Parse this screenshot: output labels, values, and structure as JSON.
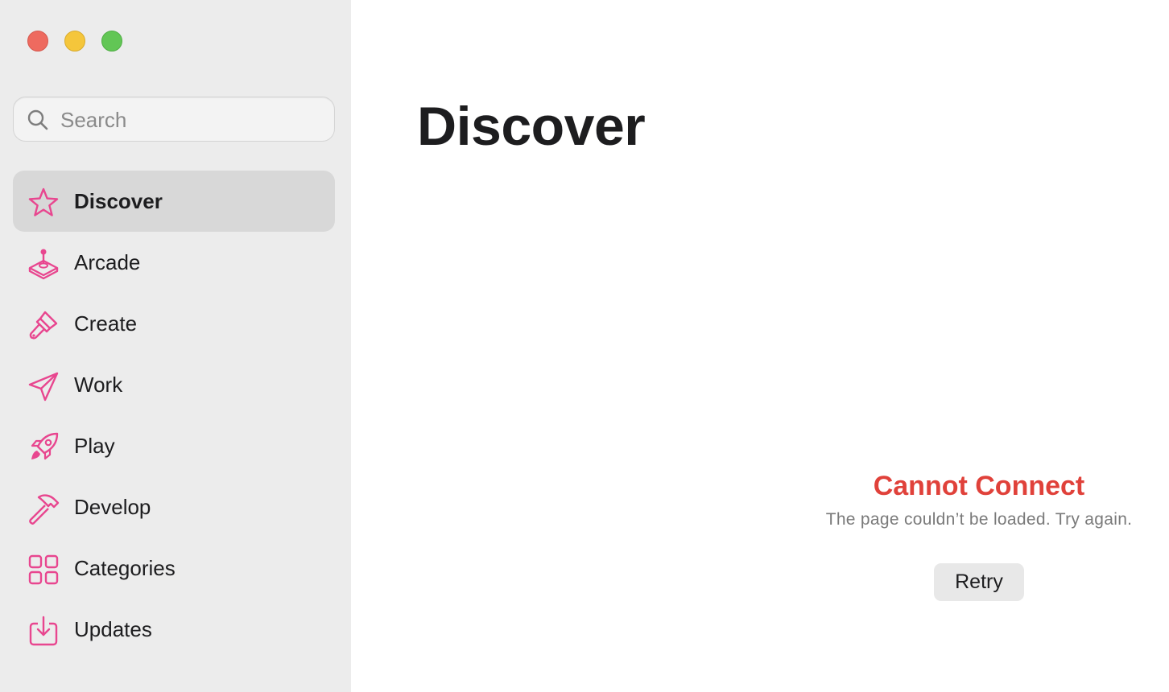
{
  "window": {
    "controls": [
      "close",
      "minimize",
      "zoom"
    ]
  },
  "search": {
    "placeholder": "Search",
    "value": ""
  },
  "sidebar": {
    "items": [
      {
        "label": "Discover",
        "icon": "star-icon",
        "active": true
      },
      {
        "label": "Arcade",
        "icon": "joystick-icon"
      },
      {
        "label": "Create",
        "icon": "paintbrush-icon"
      },
      {
        "label": "Work",
        "icon": "paperplane-icon"
      },
      {
        "label": "Play",
        "icon": "rocket-icon"
      },
      {
        "label": "Develop",
        "icon": "hammer-icon"
      },
      {
        "label": "Categories",
        "icon": "grid-icon"
      },
      {
        "label": "Updates",
        "icon": "download-tray-icon"
      }
    ]
  },
  "main": {
    "title": "Discover",
    "error_title": "Cannot Connect",
    "error_message": "The page couldn’t be loaded. Try again.",
    "retry_label": "Retry"
  },
  "colors": {
    "accent_icon": "#e8468f",
    "error": "#e0413a",
    "sidebar_bg": "#ececec",
    "active_item_bg": "#d8d8d8"
  }
}
